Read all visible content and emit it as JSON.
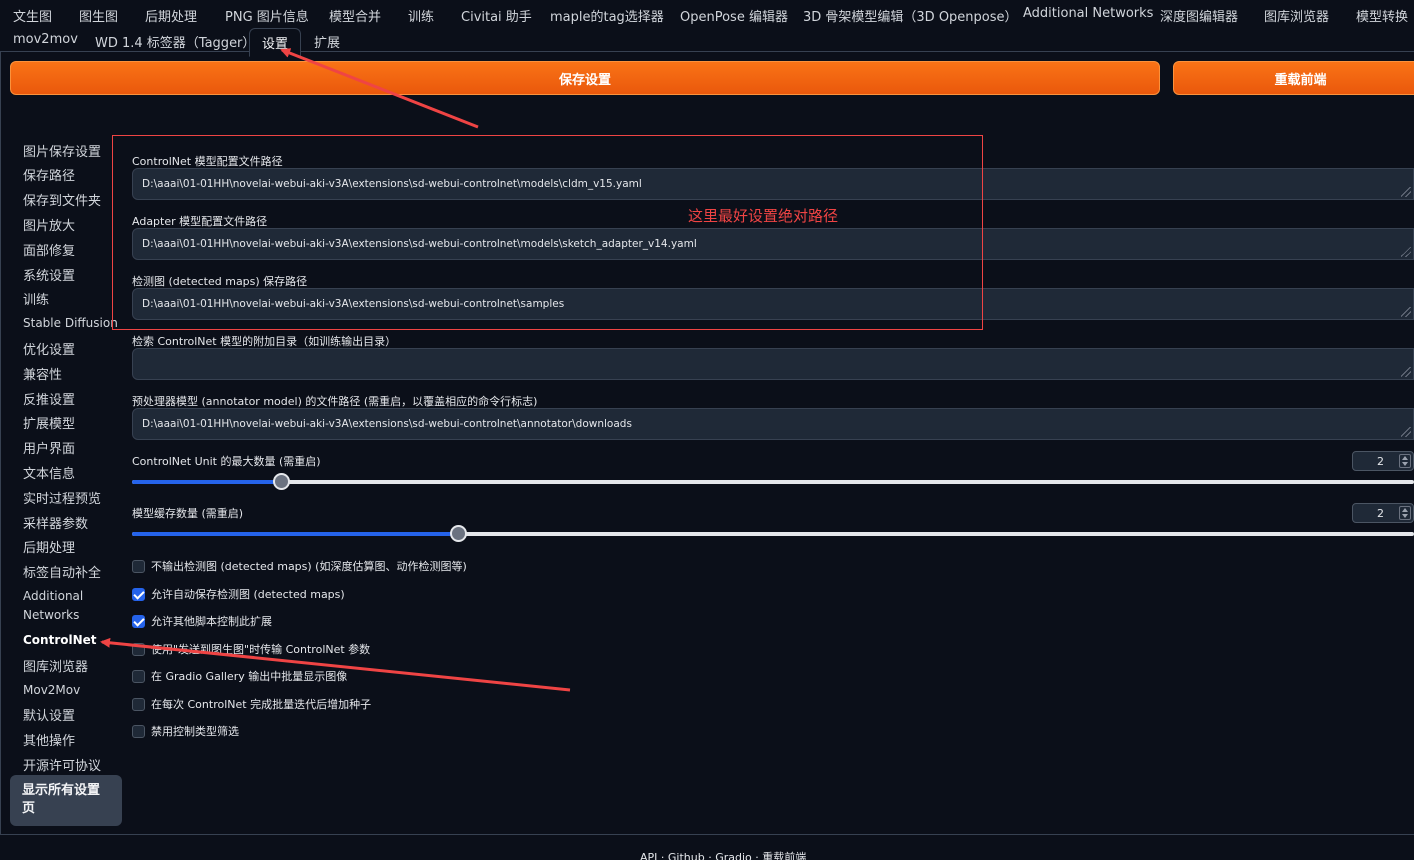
{
  "tabs_row1": [
    "文生图",
    "图生图",
    "后期处理",
    "PNG 图片信息",
    "模型合并",
    "训练",
    "Civitai 助手",
    "maple的tag选择器",
    "OpenPose 编辑器",
    "3D 骨架模型编辑（3D Openpose）",
    "Additional Networks",
    "深度图编辑器",
    "图库浏览器",
    "模型转换"
  ],
  "tabs_row2": [
    "mov2mov",
    "WD 1.4 标签器（Tagger）",
    "设置",
    "扩展"
  ],
  "buttons": {
    "save": "保存设置",
    "reload": "重载前端"
  },
  "sidebar": {
    "items": [
      "图片保存设置",
      "保存路径",
      "保存到文件夹",
      "图片放大",
      "面部修复",
      "系统设置",
      "训练",
      "Stable Diffusion",
      "优化设置",
      "兼容性",
      "反推设置",
      "扩展模型",
      "用户界面",
      "文本信息",
      "实时过程预览",
      "采样器参数",
      "后期处理",
      "标签自动补全",
      "Additional",
      "Networks",
      "ControlNet",
      "图库浏览器",
      "Mov2Mov",
      "默认设置",
      "其他操作",
      "开源许可协议"
    ],
    "show_all": "显示所有设置页"
  },
  "fields": {
    "f1": {
      "label": "ControlNet 模型配置文件路径",
      "value": "D:\\aaai\\01-01HH\\novelai-webui-aki-v3A\\extensions\\sd-webui-controlnet\\models\\cldm_v15.yaml"
    },
    "f2": {
      "label": "Adapter 模型配置文件路径",
      "value": "D:\\aaai\\01-01HH\\novelai-webui-aki-v3A\\extensions\\sd-webui-controlnet\\models\\sketch_adapter_v14.yaml"
    },
    "f3": {
      "label": "检测图 (detected maps) 保存路径",
      "value": "D:\\aaai\\01-01HH\\novelai-webui-aki-v3A\\extensions\\sd-webui-controlnet\\samples"
    },
    "f4": {
      "label": "检索 ControlNet 模型的附加目录（如训练输出目录）",
      "value": ""
    },
    "f5": {
      "label": "预处理器模型 (annotator model) 的文件路径 (需重启，以覆盖相应的命令行标志)",
      "value": "D:\\aaai\\01-01HH\\novelai-webui-aki-v3A\\extensions\\sd-webui-controlnet\\annotator\\downloads"
    }
  },
  "sliders": {
    "units": {
      "label": "ControlNet Unit 的最大数量 (需重启)",
      "value": "2",
      "fraction": 0.116
    },
    "cache": {
      "label": "模型缓存数量 (需重启)",
      "value": "2",
      "fraction": 0.254
    }
  },
  "checkboxes": [
    {
      "label": "不输出检测图 (detected maps) (如深度估算图、动作检测图等)",
      "checked": false
    },
    {
      "label": "允许自动保存检测图 (detected maps)",
      "checked": true
    },
    {
      "label": "允许其他脚本控制此扩展",
      "checked": true
    },
    {
      "label": "使用\"发送到图生图\"时传输 ControlNet 参数",
      "checked": false
    },
    {
      "label": "在 Gradio Gallery 输出中批量显示图像",
      "checked": false
    },
    {
      "label": "在每次 ControlNet 完成批量迭代后增加种子",
      "checked": false
    },
    {
      "label": "禁用控制类型筛选",
      "checked": false
    }
  ],
  "annotation": "这里最好设置绝对路径",
  "footer": "API  ·  Github  ·  Gradio  ·  重载前端",
  "colors": {
    "accent": "#f97316",
    "annotation": "#ef4444",
    "check": "#2563eb",
    "bg": "#0b0f19"
  }
}
